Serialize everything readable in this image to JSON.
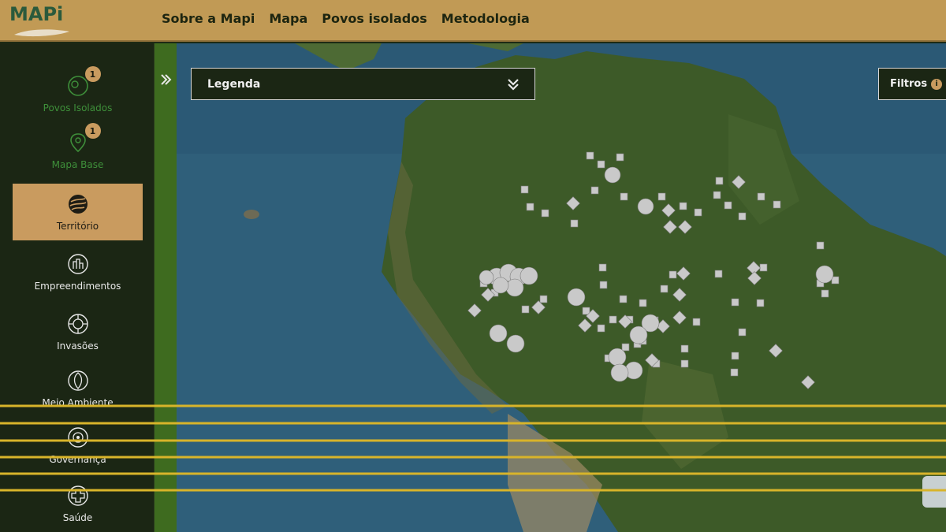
{
  "app": {
    "logo_text": "MAPi"
  },
  "nav": {
    "items": [
      "Sobre a Mapi",
      "Mapa",
      "Povos isolados",
      "Metodologia"
    ]
  },
  "sidebar": {
    "items": [
      {
        "label": "Povos Isolados",
        "icon": "isolated-peoples-icon",
        "badge": "1",
        "state": "enabled"
      },
      {
        "label": "Mapa Base",
        "icon": "map-pin-icon",
        "badge": "1",
        "state": "enabled"
      },
      {
        "label": "Território",
        "icon": "territory-icon",
        "state": "active"
      },
      {
        "label": "Empreendimentos",
        "icon": "enterprises-icon"
      },
      {
        "label": "Invasões",
        "icon": "invasions-icon"
      },
      {
        "label": "Meio Ambiente",
        "icon": "environment-icon"
      },
      {
        "label": "Governança",
        "icon": "governance-icon"
      },
      {
        "label": "Saúde",
        "icon": "health-icon"
      }
    ]
  },
  "map": {
    "legend_label": "Legenda",
    "filters_label": "Filtros",
    "filters_info": "i"
  },
  "colors": {
    "topbar": "#c19a55",
    "sidebar": "#1b2614",
    "active": "#c99b5f",
    "green_strip": "#3e6b1f",
    "ocean": "#2f5f7a",
    "land": "#3d5a28",
    "marker": "#c9c9c9",
    "overlay_lines": "#d8b42a"
  }
}
